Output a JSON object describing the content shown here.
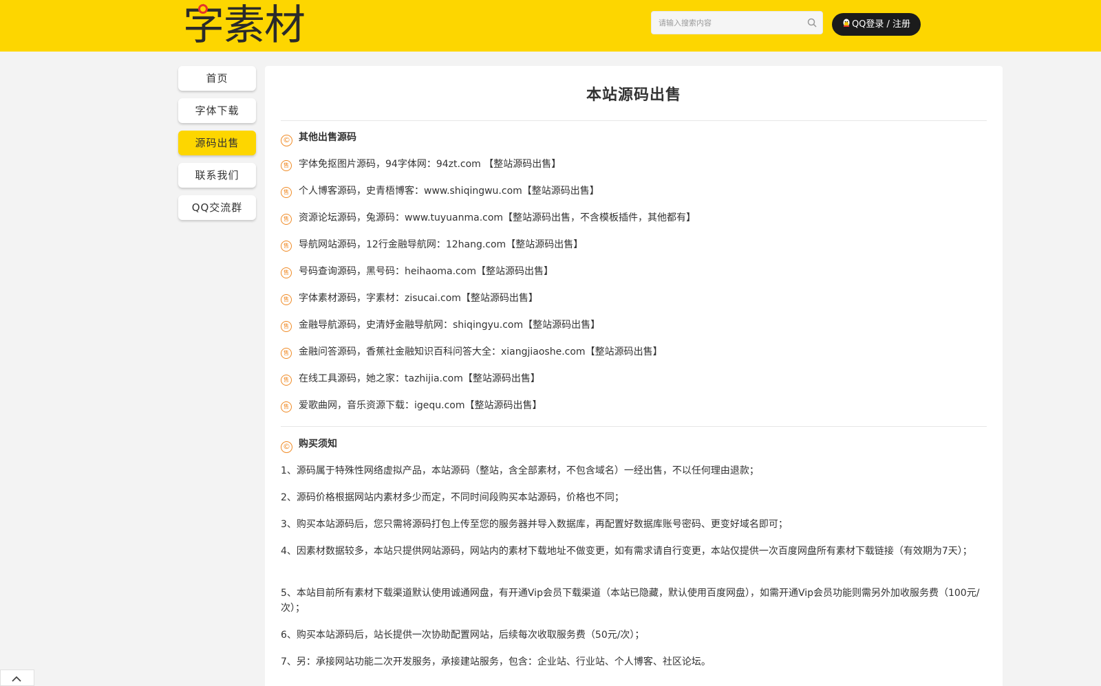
{
  "header": {
    "logo_text": "字素材",
    "search_placeholder": "请输入搜索内容",
    "login_label": "QQ登录 / 注册"
  },
  "sidebar": {
    "items": [
      {
        "label": "首页",
        "active": false
      },
      {
        "label": "字体下载",
        "active": false
      },
      {
        "label": "源码出售",
        "active": true
      },
      {
        "label": "联系我们",
        "active": false
      },
      {
        "label": "QQ交流群",
        "active": false
      }
    ]
  },
  "main": {
    "title": "本站源码出售",
    "sources_heading": "其他出售源码",
    "sources": [
      "字体免抠图片源码，94字体网：94zt.com 【整站源码出售】",
      "个人博客源码，史青梧博客：www.shiqingwu.com【整站源码出售】",
      "资源论坛源码，兔源码：www.tuyuanma.com【整站源码出售，不含模板插件，其他都有】",
      "导航网站源码，12行金融导航网：12hang.com【整站源码出售】",
      "号码查询源码，黑号码：heihaoma.com【整站源码出售】",
      "字体素材源码，字素材：zisucai.com【整站源码出售】",
      "金融导航源码，史清妤金融导航网：shiqingyu.com【整站源码出售】",
      "金融问答源码，香蕉社金融知识百科问答大全：xiangjiaoshe.com【整站源码出售】",
      "在线工具源码，她之家：tazhijia.com【整站源码出售】",
      "爱歌曲网，音乐资源下载：igequ.com【整站源码出售】"
    ],
    "notice_heading": "购买须知",
    "notices": [
      "1、源码属于特殊性网络虚拟产品，本站源码（整站，含全部素材，不包含域名）一经出售，不以任何理由退款；",
      "2、源码价格根据网站内素材多少而定，不同时间段购买本站源码，价格也不同；",
      "3、购买本站源码后，您只需将源码打包上传至您的服务器并导入数据库，再配置好数据库账号密码、更变好域名即可；",
      "4、因素材数据较多，本站只提供网站源码，网站内的素材下载地址不做变更，如有需求请自行变更，本站仅提供一次百度网盘所有素材下载链接（有效期为7天）；",
      "5、本站目前所有素材下载渠道默认使用诚通网盘，有开通Vip会员下载渠道（本站已隐藏，默认使用百度网盘），如需开通Vip会员功能则需另外加收服务费（100元/次）；",
      "6、购买本站源码后，站长提供一次协助配置网站，后续每次收取服务费（50元/次）；",
      "7、另：承接网站功能二次开发服务，承接建站服务，包含：企业站、行业站、个人博客、社区论坛。"
    ]
  },
  "icons": {
    "copyright": "©",
    "sale": "售"
  },
  "colors": {
    "brand_yellow": "#fdd600",
    "accent_orange": "#f08a24",
    "button_dark": "#1b1b1b"
  }
}
